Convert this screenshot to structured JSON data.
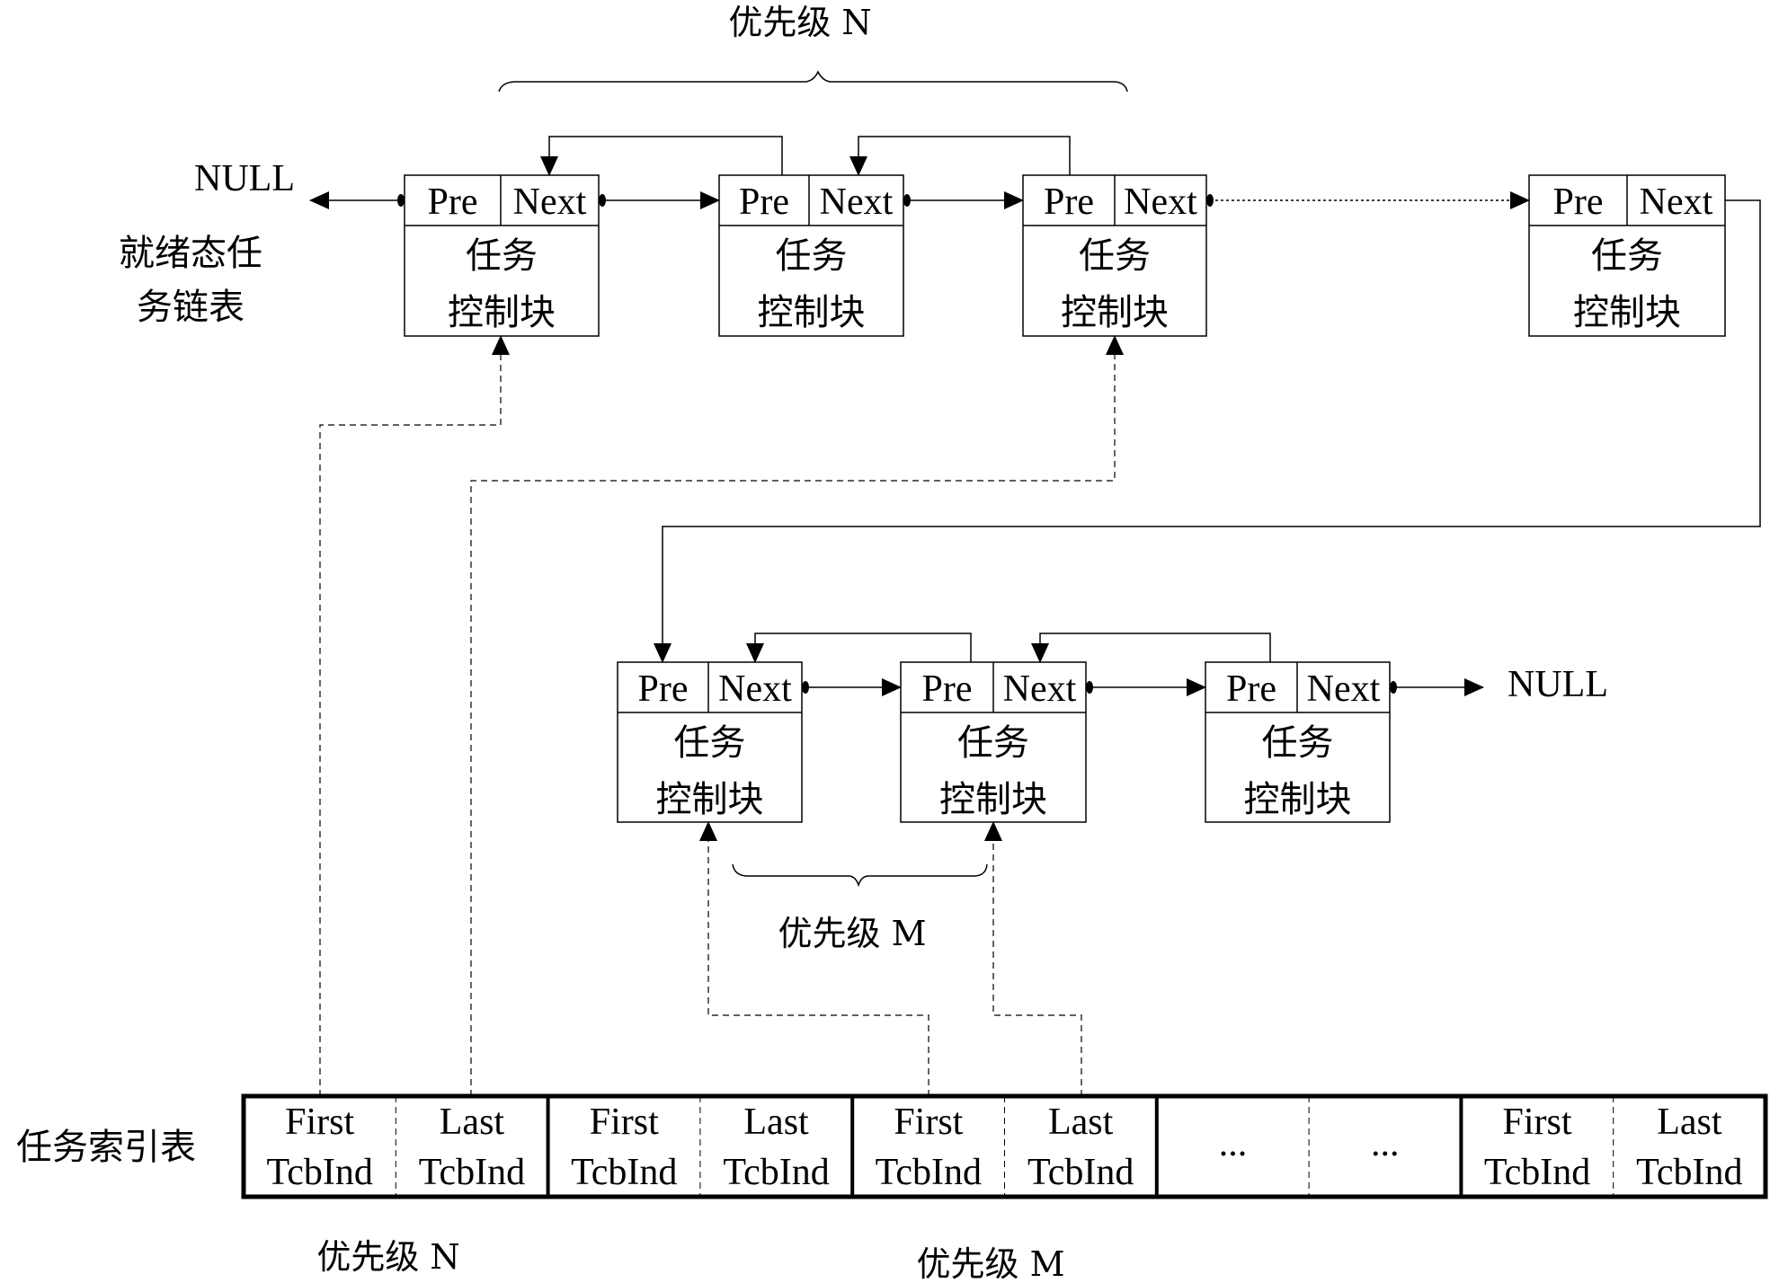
{
  "diagram": {
    "ready_list_label_line1": "就绪态任",
    "ready_list_label_line2": "务链表",
    "index_table_label": "任务索引表",
    "null_left": "NULL",
    "null_right": "NULL",
    "priority_n_top": "优先级 N",
    "priority_m_middle": "优先级 M",
    "priority_n_bottom": "优先级 N",
    "priority_m_bottom": "优先级 M",
    "node": {
      "pre": "Pre",
      "next": "Next",
      "body_line1": "任务",
      "body_line2": "控制块"
    },
    "top_row_nodes": 4,
    "middle_row_nodes": 3,
    "index_table": {
      "groups": [
        {
          "first_l1": "First",
          "first_l2": "TcbInd",
          "last_l1": "Last",
          "last_l2": "TcbInd"
        },
        {
          "first_l1": "First",
          "first_l2": "TcbInd",
          "last_l1": "Last",
          "last_l2": "TcbInd"
        },
        {
          "first_l1": "First",
          "first_l2": "TcbInd",
          "last_l1": "Last",
          "last_l2": "TcbInd"
        },
        {
          "first_l1": "...",
          "first_l2": "",
          "last_l1": "...",
          "last_l2": ""
        },
        {
          "first_l1": "First",
          "first_l2": "TcbInd",
          "last_l1": "Last",
          "last_l2": "TcbInd"
        }
      ]
    }
  }
}
